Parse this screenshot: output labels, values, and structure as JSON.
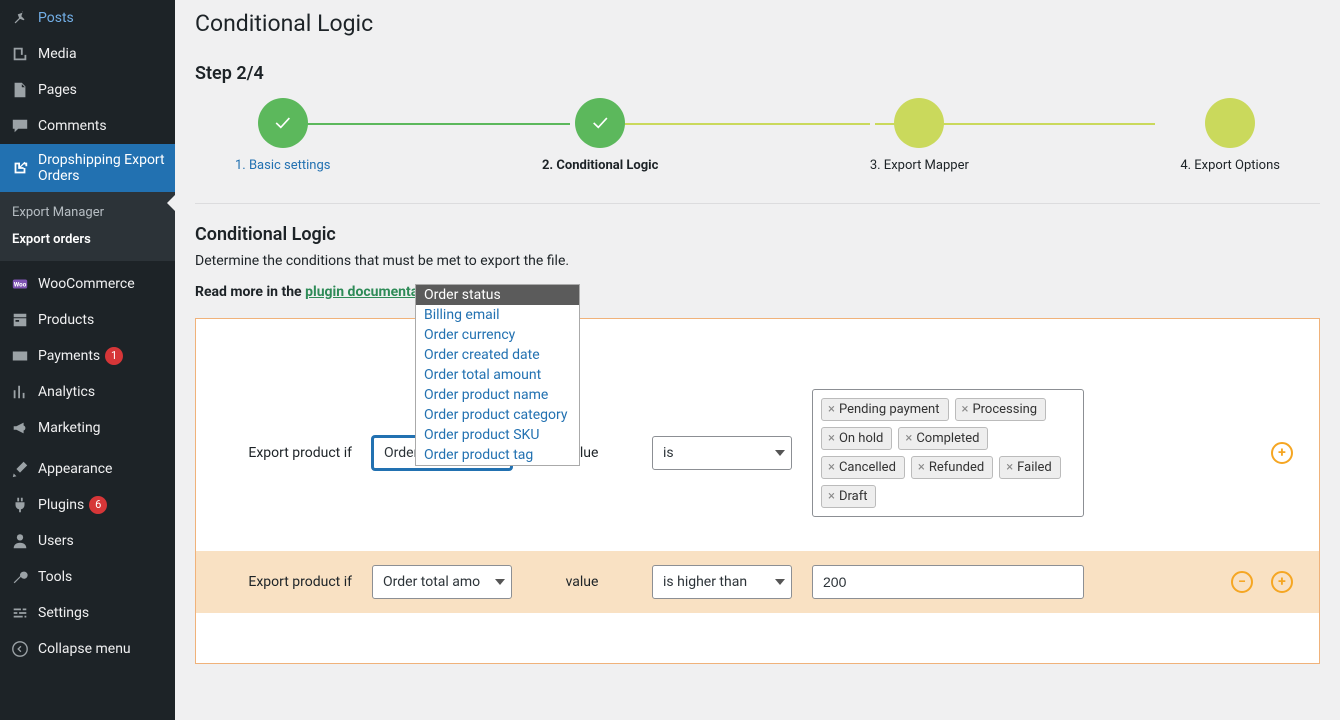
{
  "sidebar": {
    "items": [
      {
        "label": "Posts",
        "icon": "pin"
      },
      {
        "label": "Media",
        "icon": "media"
      },
      {
        "label": "Pages",
        "icon": "page"
      },
      {
        "label": "Comments",
        "icon": "comment"
      },
      {
        "label": "Dropshipping Export Orders",
        "icon": "export",
        "current": true,
        "subitems": [
          {
            "label": "Export Manager"
          },
          {
            "label": "Export orders",
            "current": true
          }
        ]
      },
      {
        "separator": true
      },
      {
        "label": "WooCommerce",
        "icon": "woo"
      },
      {
        "label": "Products",
        "icon": "box"
      },
      {
        "label": "Payments",
        "icon": "payments",
        "badge": "1"
      },
      {
        "label": "Analytics",
        "icon": "chart"
      },
      {
        "label": "Marketing",
        "icon": "megaphone"
      },
      {
        "separator": true
      },
      {
        "label": "Appearance",
        "icon": "brush"
      },
      {
        "label": "Plugins",
        "icon": "plug",
        "badge": "6"
      },
      {
        "label": "Users",
        "icon": "user"
      },
      {
        "label": "Tools",
        "icon": "wrench"
      },
      {
        "label": "Settings",
        "icon": "sliders"
      },
      {
        "label": "Collapse menu",
        "icon": "collapse"
      }
    ]
  },
  "page": {
    "title": "Conditional Logic",
    "step_label": "Step 2/4",
    "steps": [
      {
        "label": "1. Basic settings",
        "state": "done"
      },
      {
        "label": "2. Conditional Logic",
        "state": "done",
        "bold": true
      },
      {
        "label": "3. Export Mapper",
        "state": "pending"
      },
      {
        "label": "4. Export Options",
        "state": "pending"
      }
    ],
    "section_title": "Conditional Logic",
    "section_desc": "Determine the conditions that must be met to export the file.",
    "help_prefix": "Read more in the ",
    "help_link": "plugin documentation"
  },
  "dropdown_options": [
    "Order status",
    "Billing email",
    "Order currency",
    "Order created date",
    "Order total amount",
    "Order product name",
    "Order product category",
    "Order product SKU",
    "Order product tag"
  ],
  "rule1": {
    "label": "Export product if",
    "field": "Order status",
    "value_label": "value",
    "operator": "is",
    "tags": [
      "Pending payment",
      "Processing",
      "On hold",
      "Completed",
      "Cancelled",
      "Refunded",
      "Failed",
      "Draft"
    ]
  },
  "rule2": {
    "label": "Export product if",
    "field": "Order total amount",
    "field_display": "Order total amo",
    "value_label": "value",
    "operator": "is higher than",
    "value": "200"
  }
}
